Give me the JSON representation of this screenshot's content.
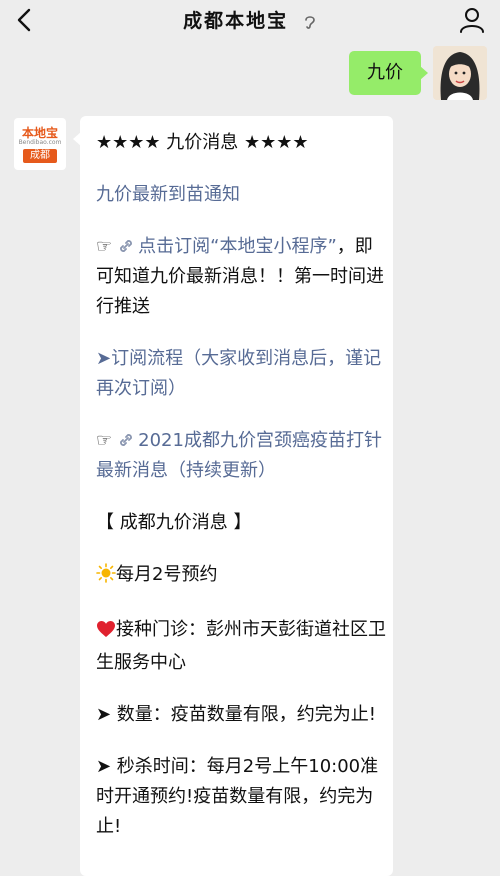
{
  "header": {
    "title": "成都本地宝",
    "back_icon": "chevron-left-icon",
    "profile_icon": "person-icon",
    "voice_icon": "ear-icon"
  },
  "user_message": {
    "text": "九价",
    "bubble_color": "#95ec69"
  },
  "bot": {
    "logo_text": "本地宝",
    "logo_url_text": "Bendibao.com",
    "logo_city": "成都",
    "brand_color": "#e65a1c"
  },
  "message": {
    "heading": "★★★★ 九价消息 ★★★★",
    "latest_link": "九价最新到苗通知",
    "subscribe_prefix": "☞",
    "subscribe_link": "点击订阅“本地宝小程序”",
    "subscribe_suffix": "，即可知道九价最新消息！！第一时间进行推送",
    "flow_link": "➤订阅流程（大家收到消息后，谨记再次订阅）",
    "news_prefix": "☞",
    "news_link": "2021成都九价宫颈癌疫苗打针最新消息（持续更新）",
    "section_title": "【 成都九价消息 】",
    "appointment": "每月2号预约",
    "clinic": "接种门诊：彭州市天彭街道社区卫生服务中心",
    "quantity": "➤ 数量：疫苗数量有限，约完为止!",
    "rush_time": "➤ 秒杀时间：每月2号上午10:00准时开通预约!疫苗数量有限，约完为止!",
    "link_color": "#576b95"
  }
}
